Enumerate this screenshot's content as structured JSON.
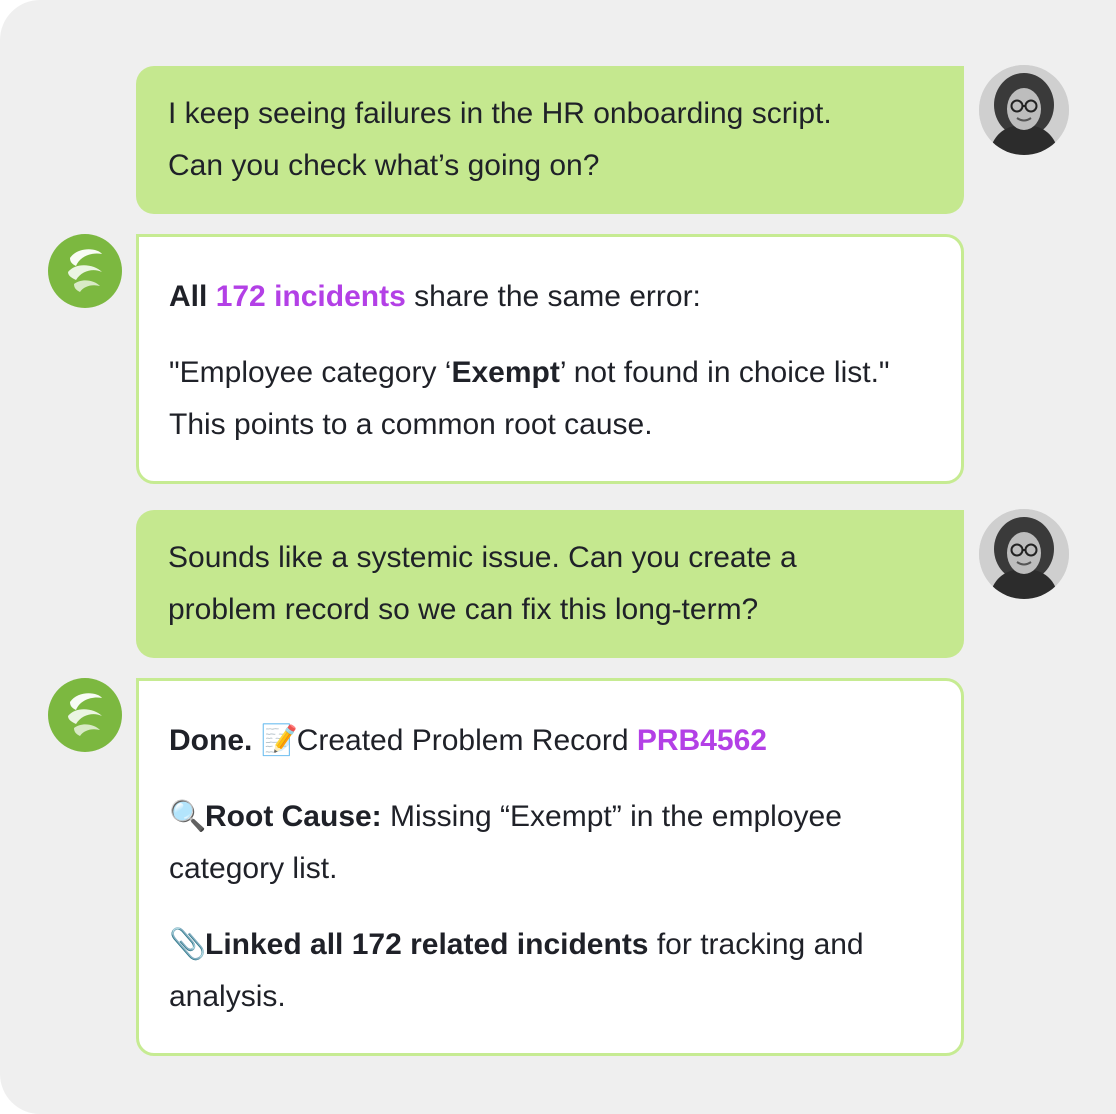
{
  "colors": {
    "user_bubble": "#c5e88f",
    "bot_border": "#c6eb92",
    "accent": "#b340e6",
    "bot_avatar": "#7cb840",
    "panel_bg": "#efefef"
  },
  "messages": [
    {
      "role": "user",
      "line1": "I keep seeing failures in the HR onboarding script.",
      "line2": "Can you check what’s going on?"
    },
    {
      "role": "assistant",
      "p1_bold": "All",
      "p1_link": "172 incidents",
      "p1_rest": "share the same error:",
      "p2_pre": "\"Employee category ‘",
      "p2_bold": "Exempt",
      "p2_post": "’ not found in choice list.\" This points to a common root cause."
    },
    {
      "role": "user",
      "line1": "Sounds like a systemic issue. Can you create a",
      "line2": "problem record so we can fix this long-term?"
    },
    {
      "role": "assistant",
      "p1_bold": "Done.",
      "p1_icon": "memo-icon",
      "p1_text": "Created Problem Record",
      "p1_link": "PRB4562",
      "p2_icon": "magnifier-icon",
      "p2_bold": "Root Cause:",
      "p2_text": "Missing “Exempt” in the employee category list.",
      "p3_icon": "paperclip-icon",
      "p3_bold": "Linked all 172 related incidents",
      "p3_text": "for tracking and analysis."
    }
  ]
}
